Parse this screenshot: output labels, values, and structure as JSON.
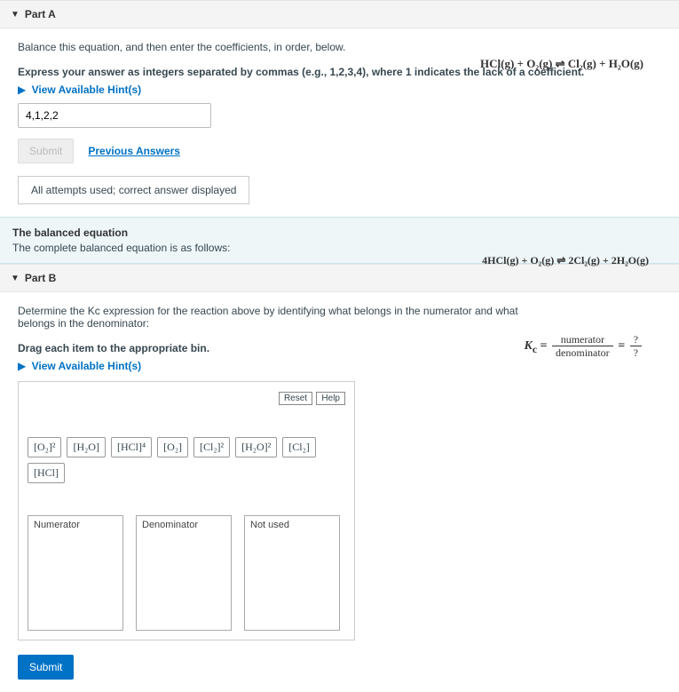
{
  "partA": {
    "title": "Part A",
    "instruction": "Balance this equation, and then enter the coefficients, in order, below.",
    "equation": "HCl(g) + O₂(g) ⇌ Cl₂(g) + H₂O(g)",
    "express": "Express your answer as integers separated by commas (e.g., 1,2,3,4), where 1 indicates the lack of a coefficient.",
    "hints_label": "View Available Hint(s)",
    "input_value": "4,1,2,2",
    "submit_label": "Submit",
    "prev_answers_label": "Previous Answers",
    "feedback": "All attempts used; correct answer displayed"
  },
  "balanced": {
    "title": "The balanced equation",
    "subtitle": "The complete balanced equation is as follows:",
    "equation": "4HCl(g) + O₂(g) ⇌ 2Cl₂(g) + 2H₂O(g)"
  },
  "partB": {
    "title": "Part B",
    "instruction": "Determine the Kc expression for the reaction above by identifying what belongs in the numerator and what belongs in the denominator:",
    "kc_left": "K",
    "kc_sub": "c",
    "kc_eq": "=",
    "kc_num_label": "numerator",
    "kc_den_label": "denominator",
    "kc_q_num": "?",
    "kc_q_den": "?",
    "drag_instruction": "Drag each item to the appropriate bin.",
    "hints_label": "View Available Hint(s)",
    "reset_label": "Reset",
    "help_label": "Help",
    "tiles": [
      "[O₂]²",
      "[H₂O]",
      "[HCl]⁴",
      "[O₂]",
      "[Cl₂]²",
      "[H₂O]²",
      "[Cl₂]",
      "[HCl]"
    ],
    "bins": {
      "numerator_label": "Numerator",
      "denominator_label": "Denominator",
      "notused_label": "Not used"
    },
    "submit_label": "Submit"
  }
}
